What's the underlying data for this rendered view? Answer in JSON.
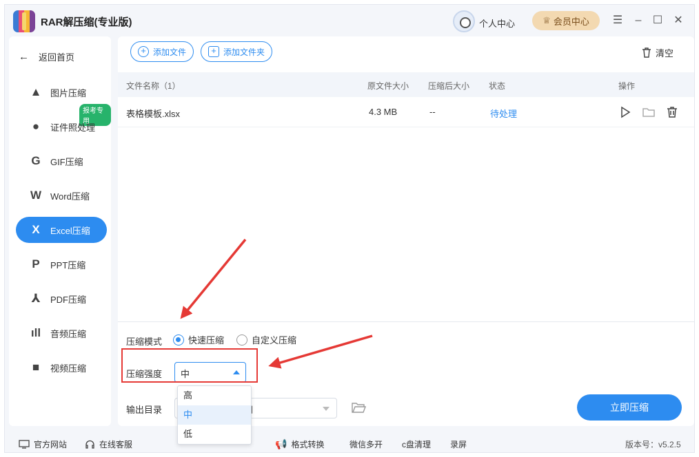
{
  "app": {
    "title": "RAR解压缩(专业版)"
  },
  "header": {
    "user_label": "个人中心",
    "vip_label": "会员中心"
  },
  "sidebar": {
    "back_label": "返回首页",
    "badge": "报考专用",
    "items": [
      {
        "label": "图片压缩",
        "icon": "image-icon",
        "glyph": "▲"
      },
      {
        "label": "证件照处理",
        "icon": "id-photo-icon",
        "glyph": "●"
      },
      {
        "label": "GIF压缩",
        "icon": "gif-icon",
        "glyph": "G"
      },
      {
        "label": "Word压缩",
        "icon": "word-icon",
        "glyph": "W"
      },
      {
        "label": "Excel压缩",
        "icon": "excel-icon",
        "glyph": "X"
      },
      {
        "label": "PPT压缩",
        "icon": "ppt-icon",
        "glyph": "P"
      },
      {
        "label": "PDF压缩",
        "icon": "pdf-icon",
        "glyph": "⅄"
      },
      {
        "label": "音频压缩",
        "icon": "audio-icon",
        "glyph": "ıll"
      },
      {
        "label": "视频压缩",
        "icon": "video-icon",
        "glyph": "■"
      }
    ]
  },
  "toolbar": {
    "add_file": "添加文件",
    "add_folder": "添加文件夹",
    "clear": "清空"
  },
  "table": {
    "headers": [
      "文件名称（1）",
      "原文件大小",
      "压缩后大小",
      "状态",
      "操作"
    ],
    "rows": [
      {
        "name": "表格模板.xlsx",
        "orig_size": "4.3 MB",
        "comp_size": "--",
        "status": "待处理"
      }
    ]
  },
  "settings": {
    "mode_label": "压缩模式",
    "mode_fast": "快速压缩",
    "mode_custom": "自定义压缩",
    "strength_label": "压缩强度",
    "strength_value": "中",
    "strength_options": [
      "高",
      "中",
      "低"
    ],
    "output_label": "输出目录",
    "output_value_tail": "间",
    "start_button": "立即压缩"
  },
  "footer": {
    "website": "官方网站",
    "support": "在线客服",
    "format_convert": "格式转换",
    "wechat_multi": "微信多开",
    "c_clean": "c盘清理",
    "record": "录屏",
    "version": "版本号：v5.2.5"
  },
  "colors": {
    "accent": "#2d8cf0",
    "badge": "#27b36b",
    "vip": "#f3d9b1",
    "annotation": "#e53935"
  }
}
